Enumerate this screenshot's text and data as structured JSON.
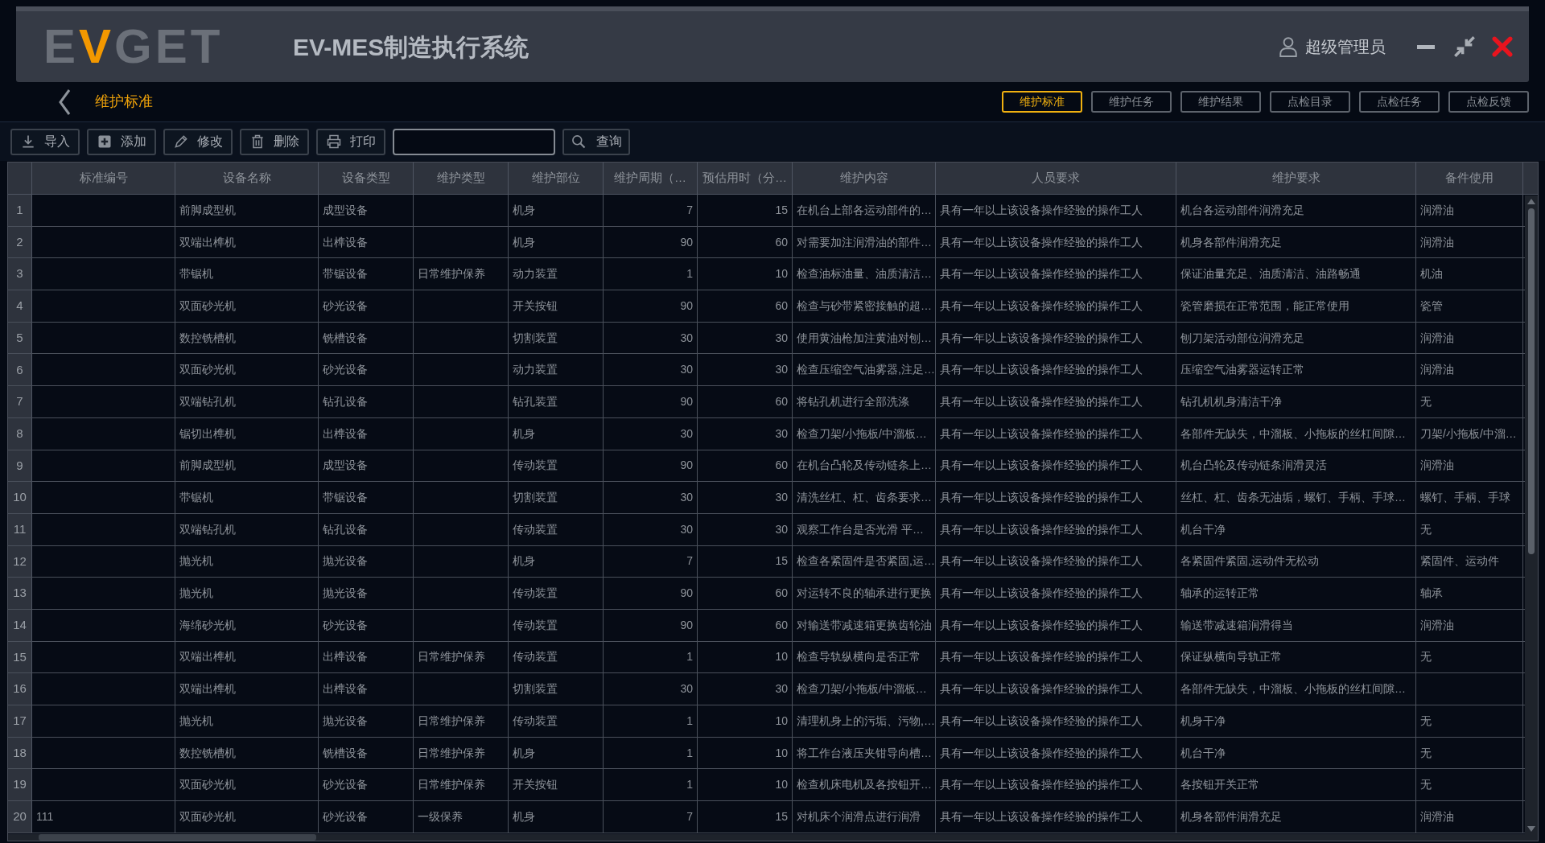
{
  "header": {
    "logo": [
      {
        "text": "E",
        "accent": false
      },
      {
        "text": "V",
        "accent": true
      },
      {
        "text": "GET",
        "accent": false
      }
    ],
    "title": "EV-MES制造执行系统",
    "user": "超级管理员"
  },
  "page_title": "维护标准",
  "nav_tabs": [
    {
      "label": "维护标准",
      "selected": true
    },
    {
      "label": "维护任务",
      "selected": false
    },
    {
      "label": "维护结果",
      "selected": false
    },
    {
      "label": "点检目录",
      "selected": false
    },
    {
      "label": "点检任务",
      "selected": false
    },
    {
      "label": "点检反馈",
      "selected": false
    }
  ],
  "toolbar": [
    {
      "kind": "import",
      "label": "导入"
    },
    {
      "kind": "add",
      "label": "添加"
    },
    {
      "kind": "edit",
      "label": "修改"
    },
    {
      "kind": "delete",
      "label": "删除"
    },
    {
      "kind": "print",
      "label": "打印"
    }
  ],
  "search_button": "查询",
  "table": {
    "columns": [
      {
        "label": "标准编号"
      },
      {
        "label": "设备名称"
      },
      {
        "label": "设备类型"
      },
      {
        "label": "维护类型"
      },
      {
        "label": "维护部位"
      },
      {
        "label": "维护周期（…"
      },
      {
        "label": "预估用时（分…"
      },
      {
        "label": "维护内容"
      },
      {
        "label": "人员要求"
      },
      {
        "label": "维护要求"
      },
      {
        "label": "备件使用"
      }
    ],
    "rows": [
      {
        "number": "1",
        "cells": [
          null,
          "前脚成型机",
          "成型设备",
          null,
          "机身",
          "7",
          "15",
          "在机台上部各运动部件的…",
          "具有一年以上该设备操作经验的操作工人",
          "机台各运动部件润滑充足",
          "润滑油"
        ]
      },
      {
        "number": "2",
        "cells": [
          null,
          "双端出榫机",
          "出榫设备",
          null,
          "机身",
          "90",
          "60",
          "对需要加注润滑油的部件…",
          "具有一年以上该设备操作经验的操作工人",
          "机身各部件润滑充足",
          "润滑油"
        ]
      },
      {
        "number": "3",
        "cells": [
          null,
          "带锯机",
          "带锯设备",
          "日常维护保养",
          "动力装置",
          "1",
          "10",
          "检查油标油量、油质清洁…",
          "具有一年以上该设备操作经验的操作工人",
          "保证油量充足、油质清洁、油路畅通",
          "机油"
        ]
      },
      {
        "number": "4",
        "cells": [
          null,
          "双面砂光机",
          "砂光设备",
          null,
          "开关按钮",
          "90",
          "60",
          "检查与砂带紧密接触的超…",
          "具有一年以上该设备操作经验的操作工人",
          "瓷管磨损在正常范围，能正常使用",
          "瓷管"
        ]
      },
      {
        "number": "5",
        "cells": [
          null,
          "数控铣槽机",
          "铣槽设备",
          null,
          "切割装置",
          "30",
          "30",
          "使用黄油枪加注黄油对刨…",
          "具有一年以上该设备操作经验的操作工人",
          "刨刀架活动部位润滑充足",
          "润滑油"
        ]
      },
      {
        "number": "6",
        "cells": [
          null,
          "双面砂光机",
          "砂光设备",
          null,
          "动力装置",
          "30",
          "30",
          "检查压缩空气油雾器,注足…",
          "具有一年以上该设备操作经验的操作工人",
          "压缩空气油雾器运转正常",
          "润滑油"
        ]
      },
      {
        "number": "7",
        "cells": [
          null,
          "双端钻孔机",
          "钻孔设备",
          null,
          "钻孔装置",
          "90",
          "60",
          "将钻孔机进行全部洗涤",
          "具有一年以上该设备操作经验的操作工人",
          "钻孔机机身清洁干净",
          "无"
        ]
      },
      {
        "number": "8",
        "cells": [
          null,
          "锯切出榫机",
          "出榫设备",
          null,
          "机身",
          "30",
          "30",
          "检查刀架/小拖板/中溜板…",
          "具有一年以上该设备操作经验的操作工人",
          "各部件无缺失，中溜板、小拖板的丝杠间隙…",
          "刀架/小拖板/中溜…"
        ]
      },
      {
        "number": "9",
        "cells": [
          null,
          "前脚成型机",
          "成型设备",
          null,
          "传动装置",
          "90",
          "60",
          "在机台凸轮及传动链条上…",
          "具有一年以上该设备操作经验的操作工人",
          "机台凸轮及传动链条润滑灵活",
          "润滑油"
        ]
      },
      {
        "number": "10",
        "cells": [
          null,
          "带锯机",
          "带锯设备",
          null,
          "切割装置",
          "30",
          "30",
          "清洗丝杠、杠、齿条要求…",
          "具有一年以上该设备操作经验的操作工人",
          "丝杠、杠、齿条无油垢，螺钉、手柄、手球…",
          "螺钉、手柄、手球"
        ]
      },
      {
        "number": "11",
        "cells": [
          null,
          "双端钻孔机",
          "钻孔设备",
          null,
          "传动装置",
          "30",
          "30",
          "观察工作台是否光滑 平…",
          "具有一年以上该设备操作经验的操作工人",
          "机台干净",
          "无"
        ]
      },
      {
        "number": "12",
        "cells": [
          null,
          "抛光机",
          "抛光设备",
          null,
          "机身",
          "7",
          "15",
          "检查各紧固件是否紧固,运…",
          "具有一年以上该设备操作经验的操作工人",
          "各紧固件紧固,运动件无松动",
          "紧固件、运动件"
        ]
      },
      {
        "number": "13",
        "cells": [
          null,
          "抛光机",
          "抛光设备",
          null,
          "传动装置",
          "90",
          "60",
          "对运转不良的轴承进行更换",
          "具有一年以上该设备操作经验的操作工人",
          "轴承的运转正常",
          "轴承"
        ]
      },
      {
        "number": "14",
        "cells": [
          null,
          "海绵砂光机",
          "砂光设备",
          null,
          "传动装置",
          "90",
          "60",
          "对输送带减速箱更换齿轮油",
          "具有一年以上该设备操作经验的操作工人",
          "输送带减速箱润滑得当",
          "润滑油"
        ]
      },
      {
        "number": "15",
        "cells": [
          null,
          "双端出榫机",
          "出榫设备",
          "日常维护保养",
          "传动装置",
          "1",
          "10",
          "检查导轨纵横向是否正常",
          "具有一年以上该设备操作经验的操作工人",
          "保证纵横向导轨正常",
          "无"
        ]
      },
      {
        "number": "16",
        "cells": [
          null,
          "双端出榫机",
          "出榫设备",
          null,
          "切割装置",
          "30",
          "30",
          "检查刀架/小拖板/中溜板…",
          "具有一年以上该设备操作经验的操作工人",
          "各部件无缺失，中溜板、小拖板的丝杠间隙…",
          null
        ]
      },
      {
        "number": "17",
        "cells": [
          null,
          "抛光机",
          "抛光设备",
          "日常维护保养",
          "传动装置",
          "1",
          "10",
          "清理机身上的污垢、污物,…",
          "具有一年以上该设备操作经验的操作工人",
          "机身干净",
          "无"
        ]
      },
      {
        "number": "18",
        "cells": [
          null,
          "数控铣槽机",
          "铣槽设备",
          "日常维护保养",
          "机身",
          "1",
          "10",
          "将工作台液压夹钳导向槽…",
          "具有一年以上该设备操作经验的操作工人",
          "机台干净",
          "无"
        ]
      },
      {
        "number": "19",
        "cells": [
          null,
          "双面砂光机",
          "砂光设备",
          "日常维护保养",
          "开关按钮",
          "1",
          "10",
          "检查机床电机及各按钮开…",
          "具有一年以上该设备操作经验的操作工人",
          "各按钮开关正常",
          "无"
        ]
      },
      {
        "number": "20",
        "cells": [
          "111",
          "双面砂光机",
          "砂光设备",
          "一级保养",
          "机身",
          "7",
          "15",
          "对机床个润滑点进行润滑",
          "具有一年以上该设备操作经验的操作工人",
          "机身各部件润滑充足",
          "润滑油"
        ]
      }
    ]
  }
}
